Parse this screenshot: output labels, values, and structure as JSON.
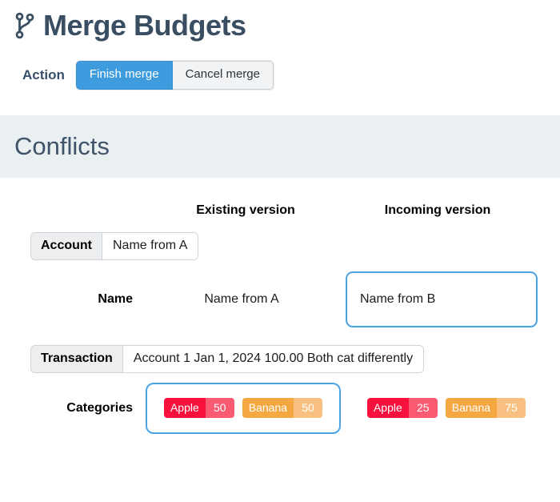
{
  "header": {
    "icon": "git-branch-icon",
    "title": "Merge Budgets"
  },
  "action": {
    "label": "Action",
    "buttons": [
      {
        "label": "Finish merge",
        "style": "primary"
      },
      {
        "label": "Cancel merge",
        "style": "default"
      }
    ]
  },
  "section": {
    "title": "Conflicts"
  },
  "columns": {
    "existing": "Existing version",
    "incoming": "Incoming version"
  },
  "rows": [
    {
      "type": "group",
      "label": "Account",
      "value": "Name from A"
    },
    {
      "type": "field",
      "label": "Name",
      "existing": "Name from A",
      "incoming": "Name from B",
      "selected": "incoming"
    },
    {
      "type": "group",
      "label": "Transaction",
      "value": "Account 1 Jan 1, 2024 100.00 Both cat differently"
    },
    {
      "type": "badges",
      "label": "Categories",
      "existing": [
        {
          "name": "Apple",
          "value": "50",
          "color": "red"
        },
        {
          "name": "Banana",
          "value": "50",
          "color": "orange"
        }
      ],
      "incoming": [
        {
          "name": "Apple",
          "value": "25",
          "color": "red"
        },
        {
          "name": "Banana",
          "value": "75",
          "color": "orange"
        }
      ],
      "selected": "existing"
    }
  ],
  "colors": {
    "title": "#3a4e63",
    "band": "#eaeff1",
    "primary_button": "#3e9bdd",
    "selection_border": "#4ba3e3",
    "badge_red": "#f8113c",
    "badge_red_light": "#fa5b72",
    "badge_orange": "#f5a742",
    "badge_orange_light": "#f8c182"
  }
}
